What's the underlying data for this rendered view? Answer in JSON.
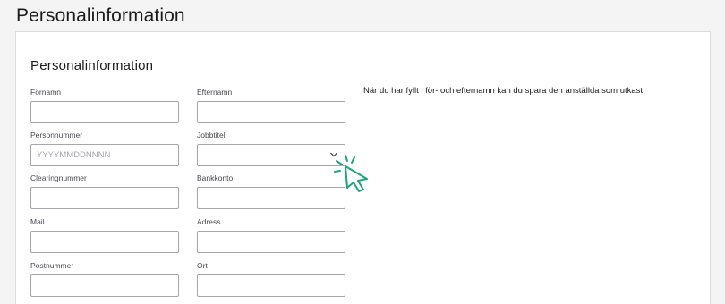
{
  "page": {
    "title": "Personalinformation"
  },
  "form": {
    "section_title": "Personalinformation",
    "info_text": "När du har fyllt i för- och efternamn kan du spara den anställda som utkast.",
    "fields": {
      "fornamn": {
        "label": "Förnamn",
        "value": ""
      },
      "efternamn": {
        "label": "Efternamn",
        "value": ""
      },
      "personnummer": {
        "label": "Personnummer",
        "value": "",
        "placeholder": "YYYYMMDDNNNN"
      },
      "jobbtitel": {
        "label": "Jobbtitel",
        "value": ""
      },
      "clearingnummer": {
        "label": "Clearingnummer",
        "value": ""
      },
      "bankkonto": {
        "label": "Bankkonto",
        "value": ""
      },
      "mail": {
        "label": "Mail",
        "value": ""
      },
      "adress": {
        "label": "Adress",
        "value": ""
      },
      "postnummer": {
        "label": "Postnummer",
        "value": ""
      },
      "ort": {
        "label": "Ort",
        "value": ""
      }
    }
  },
  "icons": {
    "dropdown": "chevron-down-icon",
    "cursor": "click-cursor-icon"
  },
  "colors": {
    "accent_cursor": "#1fa37a",
    "input_border": "#a6a6ab",
    "page_background": "#f4f4f5"
  }
}
